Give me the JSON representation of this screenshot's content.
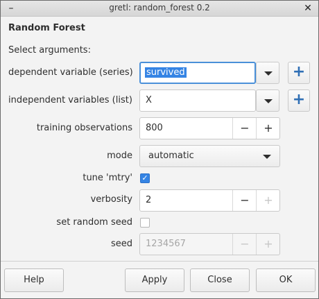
{
  "window": {
    "title": "gretl: random_forest 0.2"
  },
  "heading": "Random Forest",
  "subheading": "Select arguments:",
  "fields": {
    "dependent": {
      "label": "dependent variable (series)",
      "value": "survived"
    },
    "independent": {
      "label": "independent variables (list)",
      "value": "X"
    },
    "training": {
      "label": "training observations",
      "value": "800"
    },
    "mode": {
      "label": "mode",
      "value": "automatic"
    },
    "tune": {
      "label": "tune 'mtry'",
      "checked": true
    },
    "verbosity": {
      "label": "verbosity",
      "value": "2"
    },
    "random_seed": {
      "label": "set random seed",
      "checked": false
    },
    "seed": {
      "label": "seed",
      "value": "1234567"
    }
  },
  "icons": {
    "minus": "−",
    "plus": "+",
    "check": "✓",
    "close": "✕",
    "minimize": "–"
  },
  "buttons": {
    "help": "Help",
    "apply": "Apply",
    "close": "Close",
    "ok": "OK"
  },
  "colors": {
    "accent": "#3584e4",
    "plus_icon": "#2f6fb5"
  }
}
